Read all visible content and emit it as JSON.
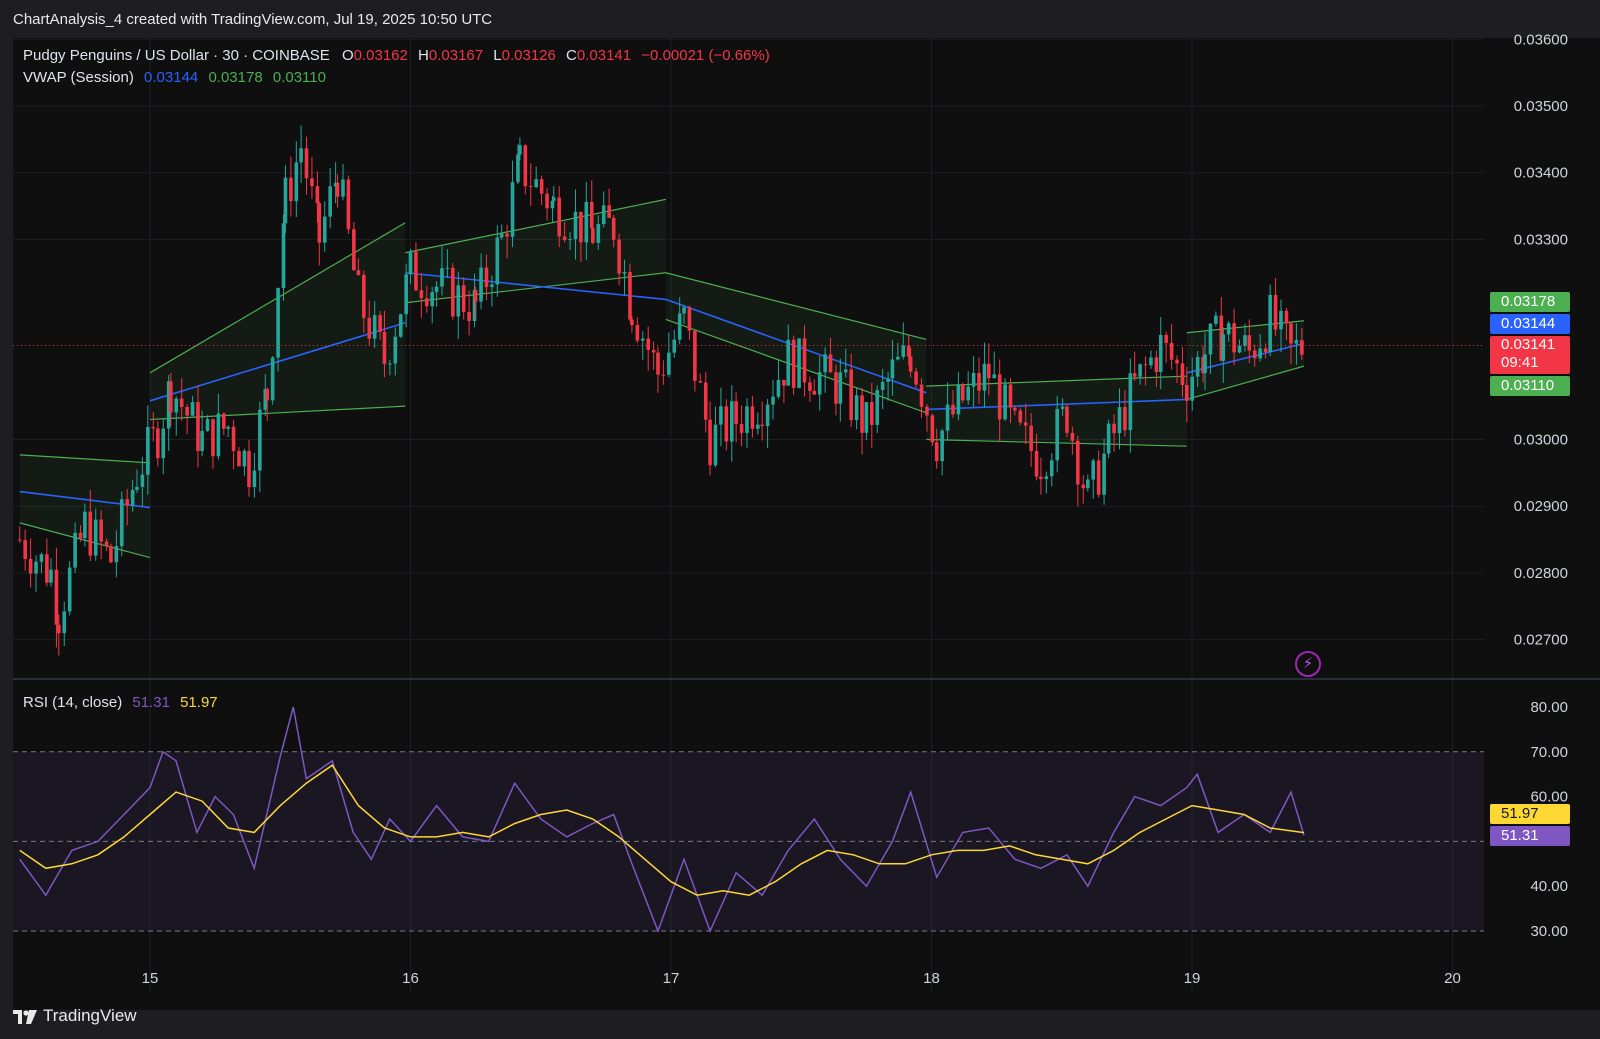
{
  "header": {
    "caption": "ChartAnalysis_4 created with TradingView.com, Jul 19, 2025 10:50 UTC"
  },
  "legend": {
    "symbol": "Pudgy Penguins / US Dollar · 30 · COINBASE",
    "open_label": "O",
    "open": "0.03162",
    "high_label": "H",
    "high": "0.03167",
    "low_label": "L",
    "low": "0.03126",
    "close_label": "C",
    "close": "0.03141",
    "change": "−0.00021 (−0.66%)",
    "vwap_label": "VWAP (Session)",
    "vwap_value": "0.03144",
    "vwap_upper": "0.03178",
    "vwap_lower": "0.03110",
    "rsi_label": "RSI (14, close)",
    "rsi_value": "51.31",
    "rsi_ma": "51.97"
  },
  "price_tags": {
    "upper": "0.03178",
    "vwap": "0.03144",
    "last": "0.03141",
    "countdown": "09:41",
    "lower": "0.03110",
    "rsi_ma": "51.97",
    "rsi": "51.31"
  },
  "footer": {
    "brand": "TradingView"
  },
  "colors": {
    "up": "#26a69a",
    "down": "#f23645",
    "vwap": "#2962ff",
    "band": "#4caf50",
    "rsi": "#7e57c2",
    "rsi_ma": "#fdd835",
    "background": "#0f0f10"
  },
  "chart_data": [
    {
      "type": "candlestick",
      "title": "Pudgy Penguins / US Dollar · 30 · COINBASE",
      "x_ticks": [
        "15",
        "16",
        "17",
        "18",
        "19",
        "20"
      ],
      "y_ticks": [
        "0.02700",
        "0.02800",
        "0.02900",
        "0.03000",
        "0.03300",
        "0.03400",
        "0.03500",
        "0.03600"
      ],
      "ylim": [
        0.0265,
        0.0361
      ],
      "last_price": 0.03141,
      "close_path": [
        [
          14.5,
          0.0285
        ],
        [
          14.62,
          0.028
        ],
        [
          14.65,
          0.0274
        ],
        [
          14.75,
          0.0287
        ],
        [
          14.85,
          0.0282
        ],
        [
          14.95,
          0.0295
        ],
        [
          15.03,
          0.0301
        ],
        [
          15.08,
          0.0308
        ],
        [
          15.2,
          0.03
        ],
        [
          15.3,
          0.0302
        ],
        [
          15.38,
          0.0296
        ],
        [
          15.45,
          0.0307
        ],
        [
          15.52,
          0.0336
        ],
        [
          15.58,
          0.0344
        ],
        [
          15.65,
          0.033
        ],
        [
          15.72,
          0.034
        ],
        [
          15.8,
          0.0321
        ],
        [
          15.9,
          0.0312
        ],
        [
          16.0,
          0.0325
        ],
        [
          16.1,
          0.0323
        ],
        [
          16.25,
          0.032
        ],
        [
          16.35,
          0.033
        ],
        [
          16.42,
          0.0341
        ],
        [
          16.55,
          0.0335
        ],
        [
          16.7,
          0.0331
        ],
        [
          16.78,
          0.0332
        ],
        [
          16.85,
          0.032
        ],
        [
          16.95,
          0.031
        ],
        [
          17.05,
          0.0318
        ],
        [
          17.15,
          0.03
        ],
        [
          17.25,
          0.0303
        ],
        [
          17.35,
          0.0306
        ],
        [
          17.45,
          0.0312
        ],
        [
          17.55,
          0.031
        ],
        [
          17.65,
          0.0308
        ],
        [
          17.75,
          0.0302
        ],
        [
          17.85,
          0.031
        ],
        [
          17.92,
          0.0313
        ],
        [
          18.02,
          0.03
        ],
        [
          18.12,
          0.0306
        ],
        [
          18.22,
          0.031
        ],
        [
          18.32,
          0.0301
        ],
        [
          18.42,
          0.0297
        ],
        [
          18.52,
          0.0304
        ],
        [
          18.6,
          0.0291
        ],
        [
          18.68,
          0.0299
        ],
        [
          18.78,
          0.0308
        ],
        [
          18.88,
          0.0314
        ],
        [
          18.98,
          0.0309
        ],
        [
          19.05,
          0.0313
        ],
        [
          19.12,
          0.0316
        ],
        [
          19.22,
          0.0313
        ],
        [
          19.3,
          0.0318
        ],
        [
          19.38,
          0.0313
        ],
        [
          19.43,
          0.03141
        ]
      ],
      "vwap_segments": [
        {
          "x": [
            14.5,
            15.0
          ],
          "vwap": [
            0.02922,
            0.02898
          ],
          "upper": [
            0.02977,
            0.02965
          ],
          "lower": [
            0.02875,
            0.02823
          ]
        },
        {
          "x": [
            15.0,
            15.98
          ],
          "vwap": [
            0.03058,
            0.03175
          ],
          "upper": [
            0.031,
            0.03325
          ],
          "lower": [
            0.0303,
            0.0305
          ]
        },
        {
          "x": [
            15.98,
            16.98
          ],
          "vwap": [
            0.0325,
            0.0321
          ],
          "upper": [
            0.0328,
            0.0336
          ],
          "lower": [
            0.03205,
            0.0325
          ]
        },
        {
          "x": [
            16.98,
            17.98
          ],
          "vwap": [
            0.0321,
            0.0307
          ],
          "upper": [
            0.0325,
            0.0315
          ],
          "lower": [
            0.0318,
            0.0304
          ]
        },
        {
          "x": [
            17.98,
            18.98
          ],
          "vwap": [
            0.03045,
            0.0306
          ],
          "upper": [
            0.0308,
            0.03095
          ],
          "lower": [
            0.03,
            0.0299
          ]
        },
        {
          "x": [
            18.98,
            19.43
          ],
          "vwap": [
            0.031,
            0.03144
          ],
          "upper": [
            0.0316,
            0.03178
          ],
          "lower": [
            0.0306,
            0.0311
          ]
        }
      ]
    },
    {
      "type": "line",
      "title": "RSI (14, close)",
      "y_ticks": [
        "30.00",
        "40.00",
        "60.00",
        "70.00",
        "80.00"
      ],
      "ylim": [
        25,
        82
      ],
      "levels": [
        30,
        50,
        70
      ],
      "series": [
        {
          "name": "51.31",
          "color": "#7e57c2",
          "points": [
            [
              14.5,
              46
            ],
            [
              14.6,
              38
            ],
            [
              14.7,
              48
            ],
            [
              14.8,
              50
            ],
            [
              14.9,
              56
            ],
            [
              15.0,
              62
            ],
            [
              15.05,
              70
            ],
            [
              15.1,
              68
            ],
            [
              15.18,
              52
            ],
            [
              15.25,
              60
            ],
            [
              15.32,
              56
            ],
            [
              15.4,
              44
            ],
            [
              15.5,
              69
            ],
            [
              15.55,
              80
            ],
            [
              15.6,
              64
            ],
            [
              15.7,
              68
            ],
            [
              15.78,
              52
            ],
            [
              15.85,
              46
            ],
            [
              15.92,
              55
            ],
            [
              16.0,
              50
            ],
            [
              16.1,
              58
            ],
            [
              16.2,
              51
            ],
            [
              16.3,
              50
            ],
            [
              16.4,
              63
            ],
            [
              16.5,
              55
            ],
            [
              16.6,
              51
            ],
            [
              16.7,
              54
            ],
            [
              16.78,
              56
            ],
            [
              16.85,
              45
            ],
            [
              16.95,
              30
            ],
            [
              17.05,
              46
            ],
            [
              17.15,
              30
            ],
            [
              17.25,
              43
            ],
            [
              17.35,
              38
            ],
            [
              17.45,
              48
            ],
            [
              17.55,
              55
            ],
            [
              17.65,
              46
            ],
            [
              17.75,
              40
            ],
            [
              17.85,
              50
            ],
            [
              17.92,
              61
            ],
            [
              18.02,
              42
            ],
            [
              18.12,
              52
            ],
            [
              18.22,
              53
            ],
            [
              18.32,
              46
            ],
            [
              18.42,
              44
            ],
            [
              18.52,
              47
            ],
            [
              18.6,
              40
            ],
            [
              18.7,
              52
            ],
            [
              18.78,
              60
            ],
            [
              18.88,
              58
            ],
            [
              18.98,
              62
            ],
            [
              19.02,
              65
            ],
            [
              19.1,
              52
            ],
            [
              19.2,
              56
            ],
            [
              19.3,
              52
            ],
            [
              19.38,
              61
            ],
            [
              19.43,
              51.31
            ]
          ]
        },
        {
          "name": "51.97",
          "color": "#fdd835",
          "points": [
            [
              14.5,
              48
            ],
            [
              14.6,
              44
            ],
            [
              14.7,
              45
            ],
            [
              14.8,
              47
            ],
            [
              14.9,
              51
            ],
            [
              15.0,
              56
            ],
            [
              15.1,
              61
            ],
            [
              15.2,
              59
            ],
            [
              15.3,
              53
            ],
            [
              15.4,
              52
            ],
            [
              15.5,
              58
            ],
            [
              15.6,
              63
            ],
            [
              15.7,
              67
            ],
            [
              15.8,
              58
            ],
            [
              15.9,
              53
            ],
            [
              16.0,
              51
            ],
            [
              16.1,
              51
            ],
            [
              16.2,
              52
            ],
            [
              16.3,
              51
            ],
            [
              16.4,
              54
            ],
            [
              16.5,
              56
            ],
            [
              16.6,
              57
            ],
            [
              16.7,
              55
            ],
            [
              16.8,
              51
            ],
            [
              16.9,
              46
            ],
            [
              17.0,
              41
            ],
            [
              17.1,
              38
            ],
            [
              17.2,
              39
            ],
            [
              17.3,
              38
            ],
            [
              17.4,
              41
            ],
            [
              17.5,
              45
            ],
            [
              17.6,
              48
            ],
            [
              17.7,
              47
            ],
            [
              17.8,
              45
            ],
            [
              17.9,
              45
            ],
            [
              18.0,
              47
            ],
            [
              18.1,
              48
            ],
            [
              18.2,
              48
            ],
            [
              18.3,
              49
            ],
            [
              18.4,
              47
            ],
            [
              18.5,
              46
            ],
            [
              18.6,
              45
            ],
            [
              18.7,
              48
            ],
            [
              18.8,
              52
            ],
            [
              18.9,
              55
            ],
            [
              19.0,
              58
            ],
            [
              19.1,
              57
            ],
            [
              19.2,
              56
            ],
            [
              19.3,
              53
            ],
            [
              19.43,
              51.97
            ]
          ]
        }
      ]
    }
  ]
}
